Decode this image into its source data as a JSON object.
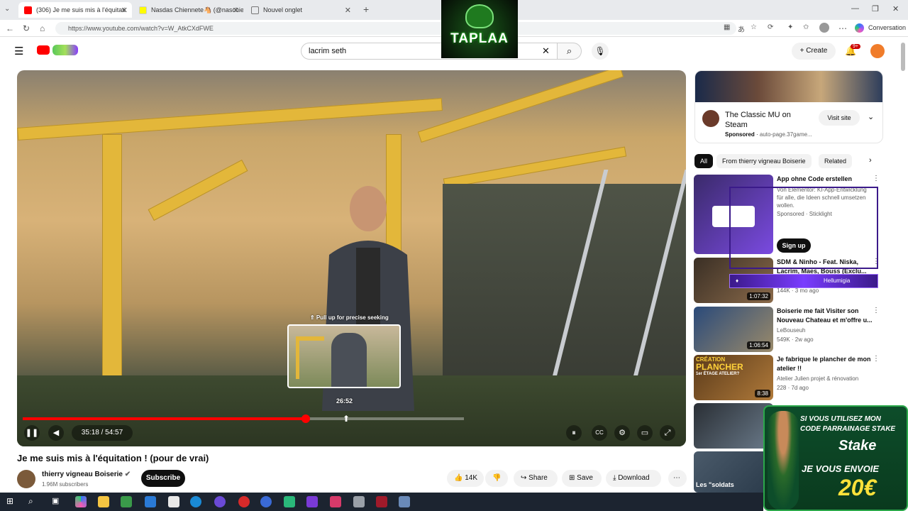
{
  "browser": {
    "tabs": [
      {
        "label": "(306) Je me suis mis à l'équitati",
        "active": true
      },
      {
        "label": "Nasdas Chiennete🐴 (@naschie",
        "active": false
      },
      {
        "label": "Nouvel onglet",
        "active": false
      }
    ],
    "url": "https://www.youtube.com/watch?v=W_AtkCXdFWE",
    "conversation_label": "Conversation"
  },
  "header": {
    "search_value": "lacrim seth",
    "create_label": "Create",
    "notifications_badge": "9+"
  },
  "overlay_logo": {
    "text": "TAPLAA"
  },
  "player": {
    "preview_hint": "⇑ Pull up for precise seeking",
    "preview_time": "26:52",
    "time_display": "35:18 / 54:57",
    "progress_fraction": 0.642,
    "hover_fraction": 0.4
  },
  "video": {
    "title": "Je me suis mis à l'équitation ! (pour de vrai)",
    "channel": "thierry vigneau Boiserie",
    "subscribers": "1.96M subscribers",
    "subscribe_label": "Subscribe",
    "likes": "14K",
    "share_label": "Share",
    "save_label": "Save",
    "download_label": "Download"
  },
  "sidebar": {
    "ad": {
      "title": "The Classic MU on Steam",
      "sponsored": "Sponsored",
      "source": "auto-page.37game...",
      "cta": "Visit site"
    },
    "chips": [
      "All",
      "From thierry vigneau Boiserie",
      "Related"
    ],
    "recommendations": [
      {
        "title": "App ohne Code erstellen",
        "desc": "Von Elementor: KI-App-Entwicklung für alle, die Ideen schnell umsetzen wollen.",
        "channel": "Sponsored · Sticklight",
        "meta": "",
        "duration": "",
        "cta": "Sign up"
      },
      {
        "title": "SDM & Ninho - Feat. Niska, Lacrim, Maes, Bouss (Exclu...",
        "channel": "",
        "meta": "144K · 3 mo ago",
        "duration": "1:07:32"
      },
      {
        "title": "Boiserie me fait Visiter son Nouveau Chateau et m'offre u...",
        "channel": "LeBouseuh",
        "meta": "549K · 2w ago",
        "duration": "1:06:54"
      },
      {
        "title": "Je fabrique le plancher de mon atelier !!",
        "channel": "Atelier Julien projet & rénovation",
        "meta": "228 · 7d ago",
        "duration": "8:38"
      }
    ],
    "thumb_texts": {
      "creation": "CRÉATION",
      "plancher": "PLANCHER",
      "etage": "1er ÉTAGE ATELIER?",
      "soldats": "Les \"soldats"
    },
    "twitch_name": "Hellumigia"
  },
  "stake_promo": {
    "line1": "SI VOUS UTILISEZ MON",
    "line2": "CODE PARRAINAGE STAKE",
    "brand": "Stake",
    "line3": "JE VOUS ENVOIE",
    "amount": "20€"
  }
}
